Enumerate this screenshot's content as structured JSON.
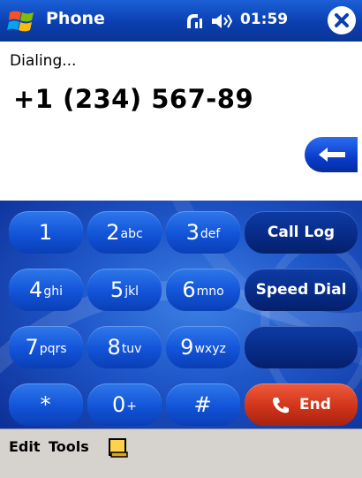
{
  "titlebar": {
    "app_title": "Phone",
    "time": "01:59",
    "icons": [
      "windows-flag-icon",
      "signal-icon",
      "volume-icon",
      "close-icon"
    ]
  },
  "display": {
    "status": "Dialing...",
    "number": "+1 (234) 567-89",
    "backspace_icon": "arrow-left-icon"
  },
  "keypad": {
    "keys": [
      {
        "digit": "1",
        "letters": ""
      },
      {
        "digit": "2",
        "letters": "abc"
      },
      {
        "digit": "3",
        "letters": "def"
      },
      {
        "digit": "4",
        "letters": "ghi"
      },
      {
        "digit": "5",
        "letters": "jkl"
      },
      {
        "digit": "6",
        "letters": "mno"
      },
      {
        "digit": "7",
        "letters": "pqrs"
      },
      {
        "digit": "8",
        "letters": "tuv"
      },
      {
        "digit": "9",
        "letters": "wxyz"
      },
      {
        "digit": "*",
        "letters": ""
      },
      {
        "digit": "0",
        "letters": "+"
      },
      {
        "digit": "#",
        "letters": ""
      }
    ],
    "call_log_label": "Call Log",
    "speed_dial_label": "Speed Dial",
    "end_label": "End"
  },
  "menubar": {
    "edit_label": "Edit",
    "tools_label": "Tools",
    "sip_icon": "keyboard-icon"
  },
  "colors": {
    "title_bar": "#0b3fb0",
    "keypad_background": "#1f57c9",
    "key": "#1253d8",
    "function_key": "#072a86",
    "end_key": "#d0341b",
    "menu_bar": "#d6d3ce"
  }
}
